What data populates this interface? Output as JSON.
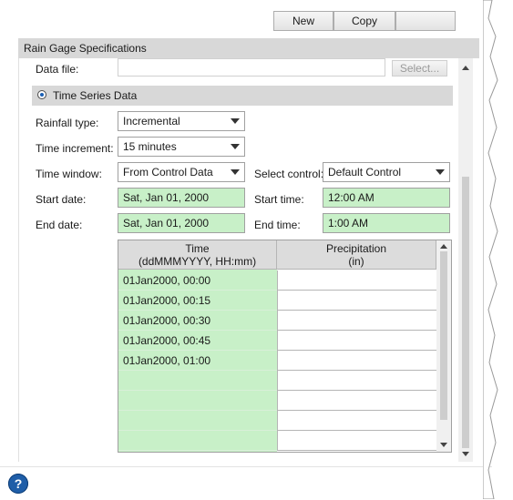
{
  "toolbar": {
    "buttons": [
      "New",
      "Copy",
      ""
    ]
  },
  "section": {
    "title": "Rain Gage Specifications"
  },
  "data_file": {
    "label": "Data file:",
    "value": "",
    "select_label": "Select..."
  },
  "time_series": {
    "header": "Time Series Data",
    "selected": true
  },
  "rainfall_type": {
    "label": "Rainfall type:",
    "value": "Incremental"
  },
  "time_increment": {
    "label": "Time increment:",
    "value": "15 minutes"
  },
  "time_window": {
    "label": "Time window:",
    "value": "From Control Data"
  },
  "select_control": {
    "label": "Select control:",
    "value": "Default Control"
  },
  "start_date": {
    "label": "Start date:",
    "value": "Sat, Jan 01, 2000"
  },
  "start_time": {
    "label": "Start time:",
    "value": "12:00 AM"
  },
  "end_date": {
    "label": "End date:",
    "value": "Sat, Jan 01, 2000"
  },
  "end_time": {
    "label": "End time:",
    "value": "1:00 AM"
  },
  "grid": {
    "time_header_1": "Time",
    "time_header_2": "(ddMMMYYYY, HH:mm)",
    "precip_header_1": "Precipitation",
    "precip_header_2": "(in)",
    "rows": [
      {
        "time": "01Jan2000, 00:00",
        "precip": ""
      },
      {
        "time": "01Jan2000, 00:15",
        "precip": ""
      },
      {
        "time": "01Jan2000, 00:30",
        "precip": ""
      },
      {
        "time": "01Jan2000, 00:45",
        "precip": ""
      },
      {
        "time": "01Jan2000, 01:00",
        "precip": ""
      },
      {
        "time": "",
        "precip": ""
      },
      {
        "time": "",
        "precip": ""
      },
      {
        "time": "",
        "precip": ""
      },
      {
        "time": "",
        "precip": ""
      }
    ]
  },
  "help": {
    "glyph": "?"
  },
  "colors": {
    "green_field": "#c8f0c8",
    "header_gray": "#d8d8d8",
    "help_blue": "#1f5ea8"
  }
}
